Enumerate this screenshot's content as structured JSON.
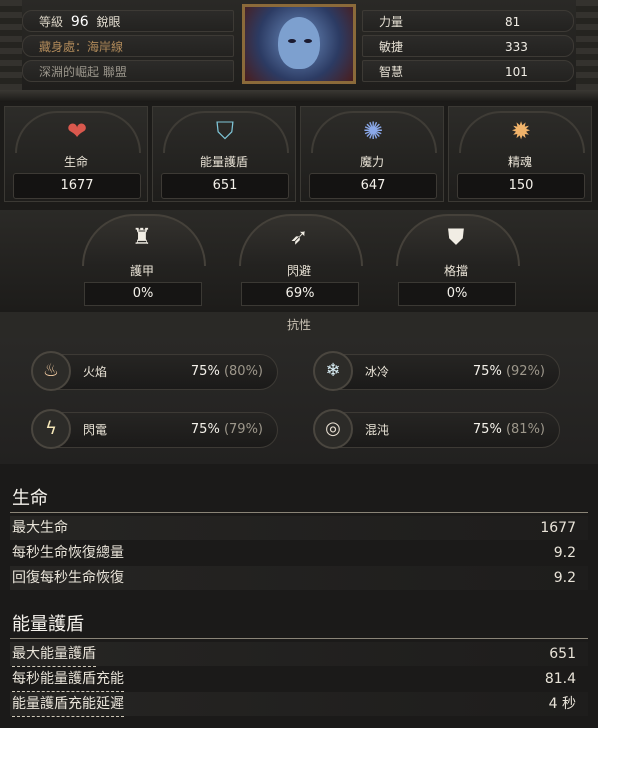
{
  "header": {
    "level_label": "等級",
    "level_value": "96",
    "class_name": "銳眼",
    "hideout": "藏身處：海岸線",
    "league": "深淵的崛起 聯盟"
  },
  "attributes": [
    {
      "name": "力量",
      "value": "81"
    },
    {
      "name": "敏捷",
      "value": "333"
    },
    {
      "name": "智慧",
      "value": "101"
    }
  ],
  "vitals": [
    {
      "label": "生命",
      "value": "1677",
      "icon": "heart-icon",
      "color": "#d9584d"
    },
    {
      "label": "能量護盾",
      "value": "651",
      "icon": "shield-icon",
      "color": "#7fc6d8"
    },
    {
      "label": "魔力",
      "value": "647",
      "icon": "mana-icon",
      "color": "#8aa8e8"
    },
    {
      "label": "精魂",
      "value": "150",
      "icon": "spirit-icon",
      "color": "#f0b36a"
    }
  ],
  "defences": [
    {
      "label": "護甲",
      "value": "0%",
      "icon": "armour-icon"
    },
    {
      "label": "閃避",
      "value": "69%",
      "icon": "evasion-icon"
    },
    {
      "label": "格擋",
      "value": "0%",
      "icon": "block-icon"
    }
  ],
  "resist_title": "抗性",
  "resistances": [
    {
      "name": "火焰",
      "value": "75%",
      "max": "(80%)",
      "icon": "fire-icon",
      "glyph": "♨"
    },
    {
      "name": "冰冷",
      "value": "75%",
      "max": "(92%)",
      "icon": "cold-icon",
      "glyph": "❄"
    },
    {
      "name": "閃電",
      "value": "75%",
      "max": "(79%)",
      "icon": "lightning-icon",
      "glyph": "ϟ"
    },
    {
      "name": "混沌",
      "value": "75%",
      "max": "(81%)",
      "icon": "chaos-icon",
      "glyph": "◎"
    }
  ],
  "sections": [
    {
      "title": "生命",
      "rows": [
        {
          "label": "最大生命",
          "value": "1677"
        },
        {
          "label": "每秒生命恢復總量",
          "value": "9.2"
        },
        {
          "label": "回復每秒生命恢復",
          "value": "9.2"
        }
      ]
    },
    {
      "title": "能量護盾",
      "rows": [
        {
          "label": "最大能量護盾",
          "value": "651"
        },
        {
          "label": "每秒能量護盾充能",
          "value": "81.4"
        },
        {
          "label": "能量護盾充能延遲",
          "value": "4 秒"
        }
      ]
    }
  ]
}
